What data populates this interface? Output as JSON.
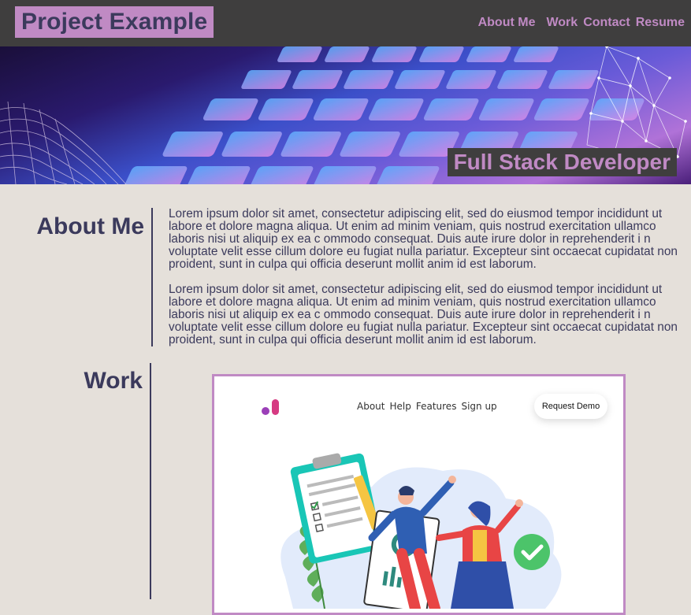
{
  "header": {
    "logo": "Project Example",
    "nav": [
      "About Me",
      "Work",
      "Contact",
      "Resume"
    ]
  },
  "hero": {
    "title": "Full Stack Developer"
  },
  "about": {
    "title": "About Me",
    "paragraphs": [
      "Lorem ipsum dolor sit amet, consectetur adipiscing elit, sed do eiusmod tempor incididunt ut labore et dolore magna aliqua. Ut enim ad minim veniam, quis nostrud exercitation ullamco laboris nisi ut aliquip ex ea c ommodo consequat. Duis aute irure dolor in reprehenderit i n voluptate velit esse cillum dolore eu fugiat nulla pariatur. Excepteur sint occaecat cupidatat non proident, sunt in culpa qui officia deserunt mollit anim id est laborum.",
      "Lorem ipsum dolor sit amet, consectetur adipiscing elit, sed do eiusmod tempor incididunt ut labore et dolore magna aliqua. Ut enim ad minim veniam, quis nostrud exercitation ullamco laboris nisi ut aliquip ex ea c ommodo consequat. Duis aute irure dolor in reprehenderit i n voluptate velit esse cillum dolore eu fugiat nulla pariatur. Excepteur sint occaecat cupidatat non proident, sunt in culpa qui officia deserunt mollit anim id est laborum."
    ]
  },
  "work": {
    "title": "Work",
    "preview": {
      "nav": [
        "About",
        "Help",
        "Features",
        "Sign up"
      ],
      "button": "Request Demo"
    }
  },
  "colors": {
    "header_bg": "#3f3e3e",
    "accent": "#c08ac4",
    "text": "#3b3a5c",
    "page_bg": "#e5e0da"
  }
}
